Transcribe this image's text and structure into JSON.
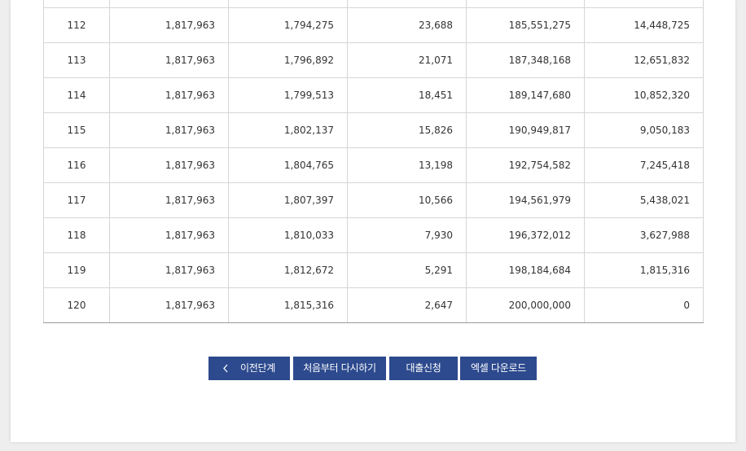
{
  "table": {
    "rows": [
      [
        "112",
        "1,817,963",
        "1,794,275",
        "23,688",
        "185,551,275",
        "14,448,725"
      ],
      [
        "113",
        "1,817,963",
        "1,796,892",
        "21,071",
        "187,348,168",
        "12,651,832"
      ],
      [
        "114",
        "1,817,963",
        "1,799,513",
        "18,451",
        "189,147,680",
        "10,852,320"
      ],
      [
        "115",
        "1,817,963",
        "1,802,137",
        "15,826",
        "190,949,817",
        "9,050,183"
      ],
      [
        "116",
        "1,817,963",
        "1,804,765",
        "13,198",
        "192,754,582",
        "7,245,418"
      ],
      [
        "117",
        "1,817,963",
        "1,807,397",
        "10,566",
        "194,561,979",
        "5,438,021"
      ],
      [
        "118",
        "1,817,963",
        "1,810,033",
        "7,930",
        "196,372,012",
        "3,627,988"
      ],
      [
        "119",
        "1,817,963",
        "1,812,672",
        "5,291",
        "198,184,684",
        "1,815,316"
      ],
      [
        "120",
        "1,817,963",
        "1,815,316",
        "2,647",
        "200,000,000",
        "0"
      ]
    ]
  },
  "buttons": {
    "prev_label": "이전단계",
    "restart_label": "처음부터 다시하기",
    "apply_label": "대출신청",
    "excel_label": "엑셀 다운로드"
  },
  "icons": {
    "prev": "chevron-left-icon"
  },
  "colors": {
    "button_bg": "#2d4a8e",
    "button_text": "#ffffff"
  }
}
